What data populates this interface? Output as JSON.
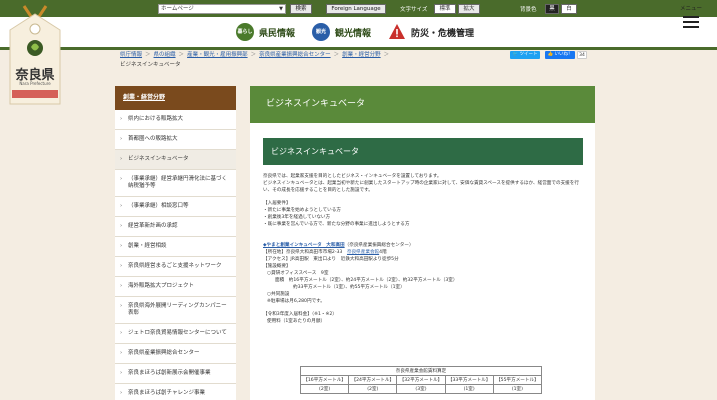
{
  "topbar": {
    "select_value": "ホームページ",
    "search_button": "検索",
    "foreign_language": "Foreign Language",
    "font_size_label": "文字サイズ",
    "font_standard": "標準",
    "font_large": "拡大",
    "bg_color_label": "背景色",
    "bg_black": "黒",
    "bg_white": "白"
  },
  "header": {
    "nav": [
      {
        "icon_text": "暮らし",
        "label": "県民情報",
        "color": "#4a7a2b"
      },
      {
        "icon_text": "観光",
        "label": "観光情報",
        "color": "#2a5ea8"
      },
      {
        "icon_text": "",
        "label": "防災・危機管理",
        "color": "#c9302c"
      }
    ],
    "menu_label": "メニュー"
  },
  "logo": {
    "name": "奈良県",
    "subtitle": "Nara Prefecture"
  },
  "breadcrumb": {
    "items": [
      "県庁情報",
      "県の組織",
      "産業・観光・雇用振興部",
      "奈良県産業振興総合センター",
      "創業・経営分野"
    ],
    "current": "ビジネスインキュベータ"
  },
  "share": {
    "tweet": "ツイート",
    "like": "いいね！",
    "count": "34"
  },
  "sidebar": {
    "title": "創業・経営分野",
    "items": [
      "県内における販路拡大",
      "首都圏への販路拡大",
      "ビジネスインキュベータ",
      "（事業承継）経営承継円滑化法に基づく納税猶予等",
      "（事業承継）相談窓口等",
      "経営革新計画の承認",
      "創業・経営相談",
      "奈良県経営まるごと支援ネットワーク",
      "海外販路拡大プロジェクト",
      "奈良県海外展開リーディングカンパニー表彰",
      "ジェトロ奈良貿易情報センターについて",
      "奈良県産業振興総合センター",
      "奈良まほろば創新展示会開催事業",
      "奈良まほろば創チャレンジ事業"
    ],
    "active_index": 2
  },
  "main": {
    "page_title": "ビジネスインキュベータ",
    "section_title": "ビジネスインキュベータ",
    "intro1": "奈良県では、起業家支援を目的としたビジネス・インキュベータを設置しております。",
    "intro2": "ビジネスインキュベータとは、起業当初や新たに創業したスタートアップ時の企業家に対して、安価な賃貸スペースを提供するほか、経営面での支援を行い、その成長を応援することを目的とした施設です。",
    "requirements_title": "【入居要件】",
    "requirements": [
      "・新たに事業を始めようとしている方",
      "・創業後3年を経過していない方",
      "・既に事業を営んでいる方で、新たな分野の事業に進出しようとする方"
    ],
    "facility_name": "◆やまと創業インキュベータ　大和高田",
    "facility_note": "（奈良県産業振興総合センター）",
    "address_label": "【所在地】",
    "address": "奈良県大和高田市市場2-33",
    "address_link": "奈良県産業会館",
    "address_tail": "4階",
    "access_label": "【アクセス】",
    "access": "JR高田駅　東出口より　近鉄大和高田駅より徒歩5分",
    "overview_label": "【施設概要】",
    "office_label": "○貸研オフィススペース　9室",
    "office_detail1": "面積　約16平方メートル（2室）、約24平方メートル（2室）、約32平方メートル（3室）",
    "office_detail2": "約33平方メートル（1室）、約55平方メートル（1室）",
    "shared_label": "○共同施設",
    "shared_detail": "会議室・給湯スペース　1室（面積　約45平方メートル）",
    "rent_note": "※駐車場は月6,280円です。",
    "fee_title": "【令和3年度入居料金】（※1・※2）",
    "fee_sub": "使用料（1室あたりの月額）",
    "table_caption": "奈良県産業会館賃料算定",
    "table_headers": [
      "【16平方メートル】",
      "【24平方メートル】",
      "【32平方メートル】",
      "【33平方メートル】",
      "【55平方メートル】"
    ],
    "table_rooms": [
      "(2室)",
      "(2室)",
      "(3室)",
      "(1室)",
      "(1室)"
    ]
  }
}
